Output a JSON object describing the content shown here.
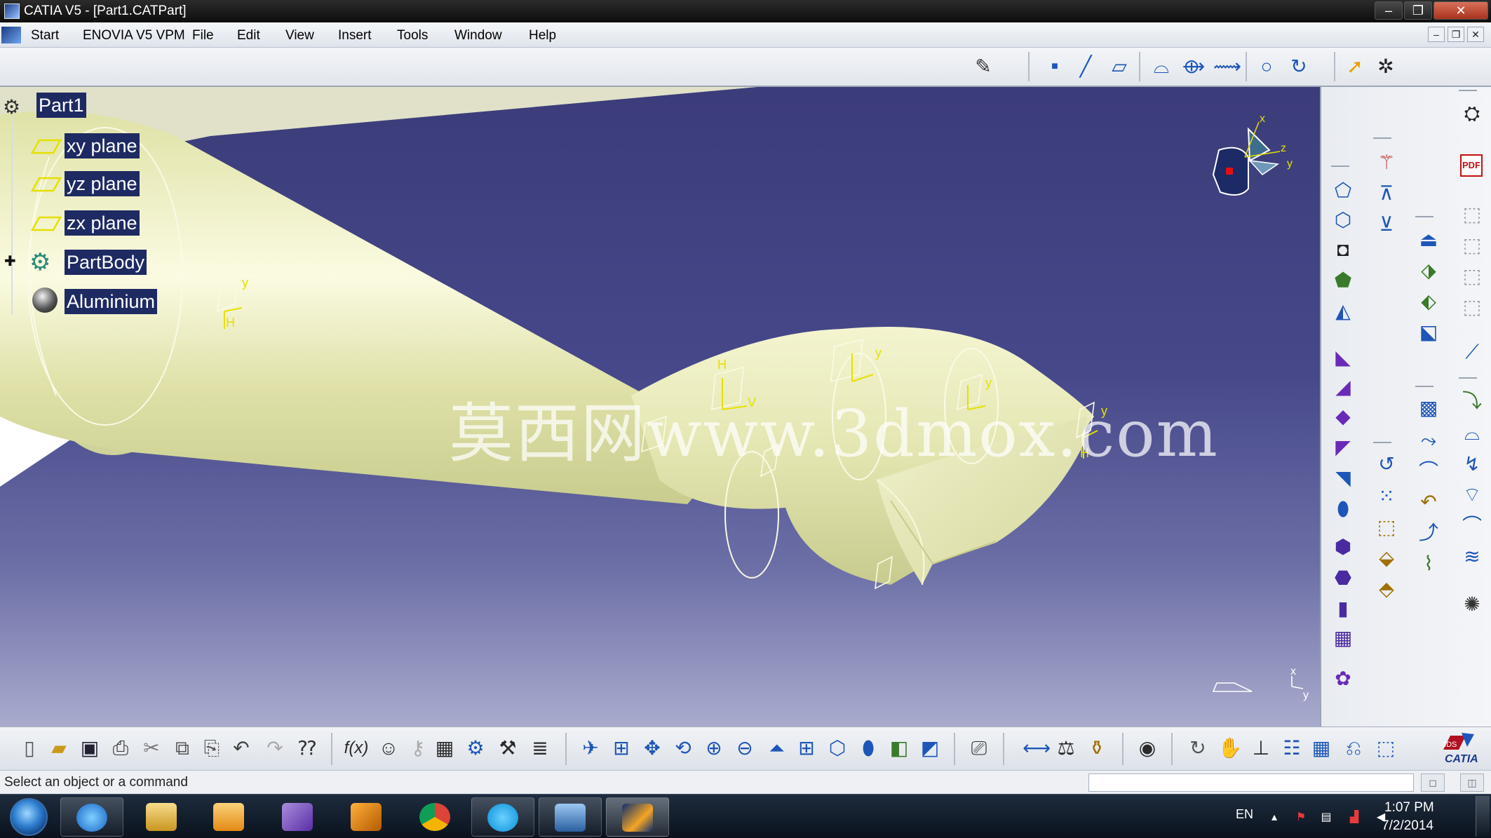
{
  "window": {
    "title": "CATIA V5 - [Part1.CATPart]",
    "minimize_glyph": "–",
    "maximize_glyph": "❐",
    "close_glyph": "✕"
  },
  "menu": {
    "items": [
      "Start",
      "ENOVIA V5 VPM",
      "File",
      "Edit",
      "View",
      "Insert",
      "Tools",
      "Window",
      "Help"
    ],
    "mdi_min": "–",
    "mdi_restore": "❐",
    "mdi_close": "✕"
  },
  "tree": {
    "root": "Part1",
    "items": [
      "xy plane",
      "yz plane",
      "zx plane",
      "PartBody",
      "Aluminium"
    ],
    "expand_glyph": "✚"
  },
  "viewport": {
    "watermark": "莫西网www.3dmox.com",
    "axis_x": "x",
    "axis_y": "y",
    "axis_z": "z",
    "feature_label_h": "H",
    "feature_label_v": "V",
    "feature_label_y": "y"
  },
  "statusbar": {
    "message": "Select an object or a command",
    "command_value": ""
  },
  "bottom_toolbar": {
    "formula_label": "f(x)",
    "brand": "CATIA",
    "brand_mark": "3DS"
  },
  "right_toolbar": {
    "pdf_label": "PDF"
  },
  "taskbar": {
    "language": "EN",
    "time": "1:07 PM",
    "date": "7/2/2014",
    "apps": [
      "internet-explorer",
      "file-explorer",
      "media-player",
      "visual-studio",
      "app-orange",
      "chrome",
      "skype",
      "image-viewer",
      "catia"
    ]
  },
  "colors": {
    "viewport_top": "#3b3c79",
    "viewport_bottom": "#a9abcd",
    "part_fill": "#e9ebb8",
    "tree_label_bg": "#1e2a62",
    "sketch_yellow": "#e5e000",
    "axis_red": "#e01010"
  }
}
